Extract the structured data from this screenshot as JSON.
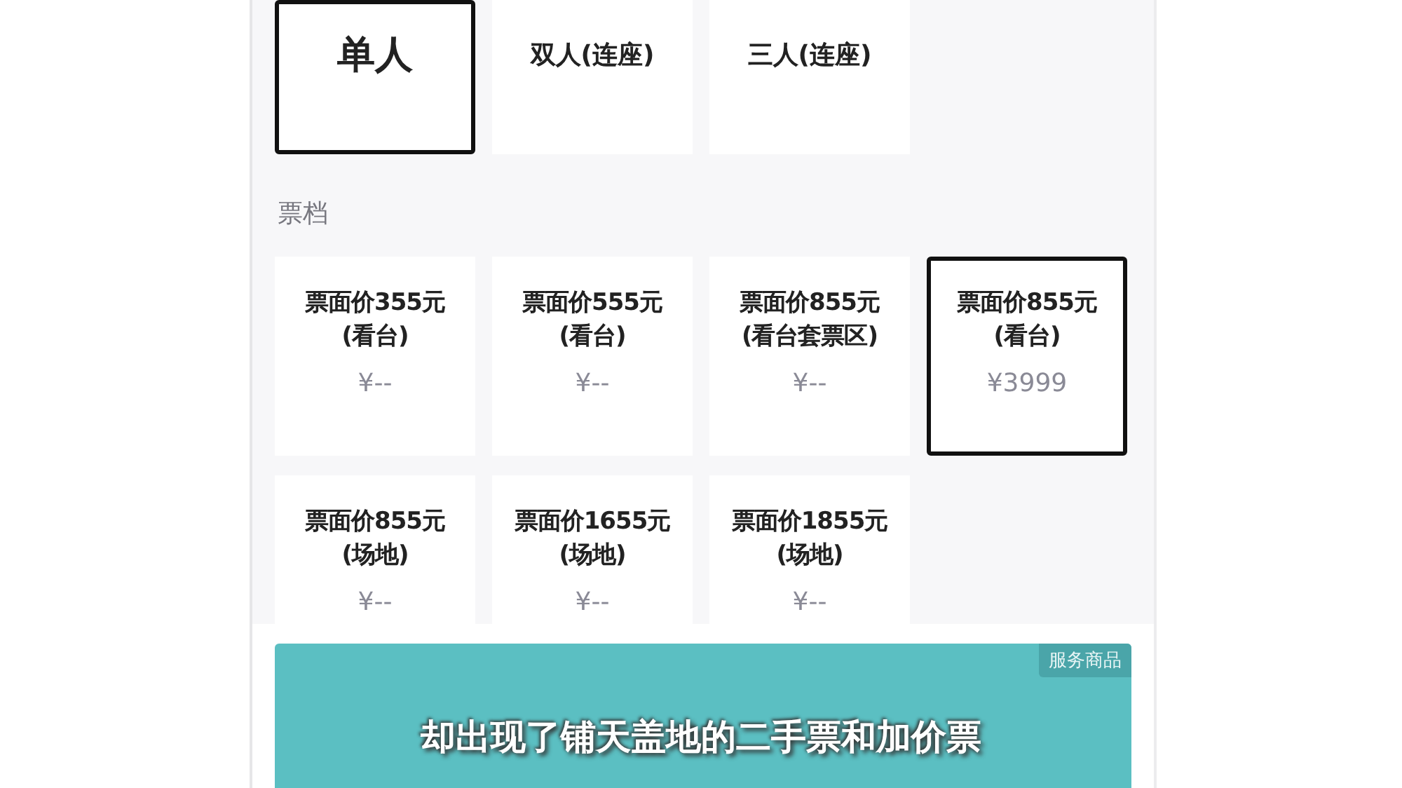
{
  "seat_options": [
    {
      "label": "单人",
      "selected": true
    },
    {
      "label": "双人(连座)",
      "selected": false
    },
    {
      "label": "三人(连座)",
      "selected": false
    }
  ],
  "tier_section": {
    "title": "票档"
  },
  "tiers": [
    {
      "name": "票面价355元",
      "area": "(看台)",
      "price": "¥--",
      "selected": false
    },
    {
      "name": "票面价555元",
      "area": "(看台)",
      "price": "¥--",
      "selected": false
    },
    {
      "name": "票面价855元",
      "area": "(看台套票区)",
      "price": "¥--",
      "selected": false
    },
    {
      "name": "票面价855元",
      "area": "(看台)",
      "price": "¥3999",
      "selected": true
    },
    {
      "name": "票面价855元",
      "area": "(场地)",
      "price": "¥--",
      "selected": false
    },
    {
      "name": "票面价1655元",
      "area": "(场地)",
      "price": "¥--",
      "selected": false
    },
    {
      "name": "票面价1855元",
      "area": "(场地)",
      "price": "¥--",
      "selected": false
    }
  ],
  "buy_bar": {
    "badge": "服务商品"
  },
  "subtitle": "却出现了铺天盖地的二手票和加价票"
}
